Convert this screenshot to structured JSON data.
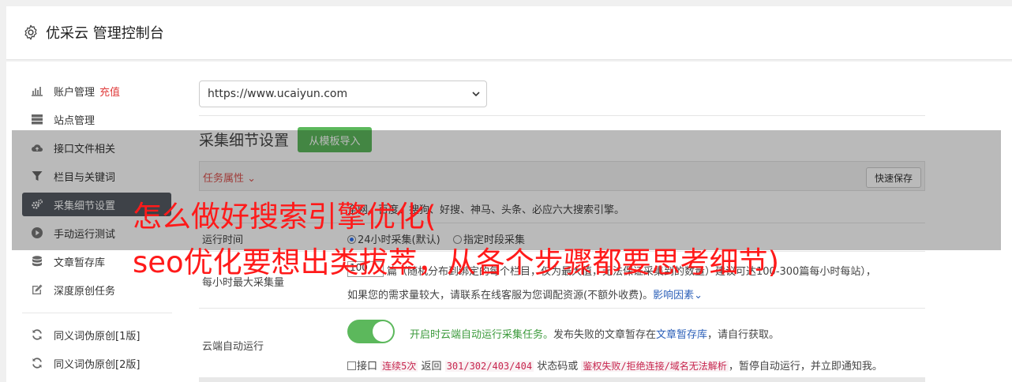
{
  "header": {
    "title": "优采云 管理控制台",
    "icon": "gear-icon"
  },
  "sidebar": {
    "items": [
      {
        "label": "账户管理",
        "accent": "充值",
        "icon": "bar-chart-icon"
      },
      {
        "label": "站点管理",
        "icon": "server-icon"
      },
      {
        "label": "接口文件相关",
        "icon": "cloud-upload-icon"
      },
      {
        "label": "栏目与关键词",
        "icon": "filter-icon"
      },
      {
        "label": "采集细节设置",
        "icon": "cogs-icon"
      },
      {
        "label": "手动运行测试",
        "icon": "play-circle-icon"
      },
      {
        "label": "文章暂存库",
        "icon": "database-icon"
      },
      {
        "label": "深度原创任务",
        "icon": "edit-icon"
      },
      {
        "label": "同义词伪原创[1版]",
        "icon": "refresh-icon"
      },
      {
        "label": "同义词伪原创[2版]",
        "icon": "refresh-icon"
      }
    ]
  },
  "site_select": {
    "value": "https://www.ucaiyun.com"
  },
  "section": {
    "title": "采集细节设置",
    "import_button": "从模板导入"
  },
  "task_bar": {
    "label": "任务属性",
    "quick_save": "快速保存"
  },
  "rows": {
    "engines_text": "全网、百度、搜狗、好搜、神马、头条、必应六大搜索引擎。",
    "run_time": {
      "label": "运行时间",
      "option1": "24小时采集(默认)",
      "option2": "指定时段采集"
    },
    "max_collect": {
      "label": "每小时最大采集量",
      "input_value": "100",
      "line1": "篇（随机分布到绑定的每个栏目，仅为最大值，无法保证采集到的数量）建议可达100-300篇每小时每站），",
      "line2": "如果您的需求量较大，请联系在线客服为您调配资源(不额外收费)。",
      "influence_link": "影响因素"
    },
    "cloud_run": {
      "label": "云端自动运行",
      "toggle_on": true,
      "desc_green": "开启时云端自动运行采集任务。",
      "desc_rest1": "发布失败的文章暂存在",
      "desc_link": "文章暂存库",
      "desc_rest2": "，请自行获取。",
      "cb_label": "接口",
      "code1": "连续5次",
      "txt1": "返回",
      "code2": "301/302/403/404",
      "txt2": "状态码或",
      "code3": "鉴权失败/拒绝连接/域名无法解析",
      "txt3": "，暂停自动运行，并立即通知我。"
    }
  },
  "overlay": {
    "line1": "怎么做好搜索引擎优化(",
    "line2": "seo优化要想出类拔萃，从各个步骤都要思考细节)"
  }
}
